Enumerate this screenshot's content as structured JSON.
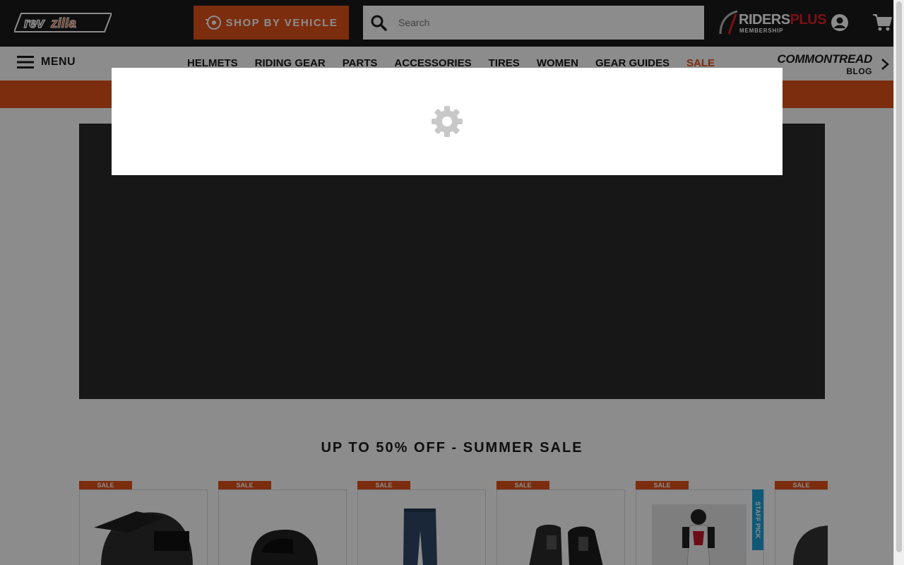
{
  "header": {
    "logo_alt": "revzilla",
    "shop_by_vehicle": "SHOP BY VEHICLE",
    "search_placeholder": "Search",
    "riders_plus": {
      "riders": "RIDERS",
      "plus": "PLUS",
      "membership": "MEMBERSHIP"
    }
  },
  "nav": {
    "menu_label": "MENU",
    "links": [
      "HELMETS",
      "RIDING GEAR",
      "PARTS",
      "ACCESSORIES",
      "TIRES",
      "WOMEN",
      "GEAR GUIDES",
      "SALE"
    ],
    "commontread": {
      "name": "COMMONTREAD",
      "sub": "BLOG"
    }
  },
  "colors": {
    "brand_orange": "#e0531a",
    "dark": "#1b1b1b",
    "staff_pick": "#1ea0d8",
    "riders_plus_red": "#e41e26"
  },
  "main": {
    "section_title": "UP TO 50% OFF - SUMMER SALE",
    "products": [
      {
        "badge": "SALE",
        "image": "helmet-dual-sport-icon"
      },
      {
        "badge": "SALE",
        "image": "helmet-full-face-icon"
      },
      {
        "badge": "SALE",
        "image": "jeans-icon"
      },
      {
        "badge": "SALE",
        "image": "boots-icon"
      },
      {
        "badge": "SALE",
        "image": "riding-suit-icon",
        "staff_pick": "STAFF PICK"
      },
      {
        "badge": "SALE",
        "image": "helmet-modular-icon"
      }
    ]
  },
  "modal": {
    "state": "loading",
    "icon": "gear-icon"
  }
}
